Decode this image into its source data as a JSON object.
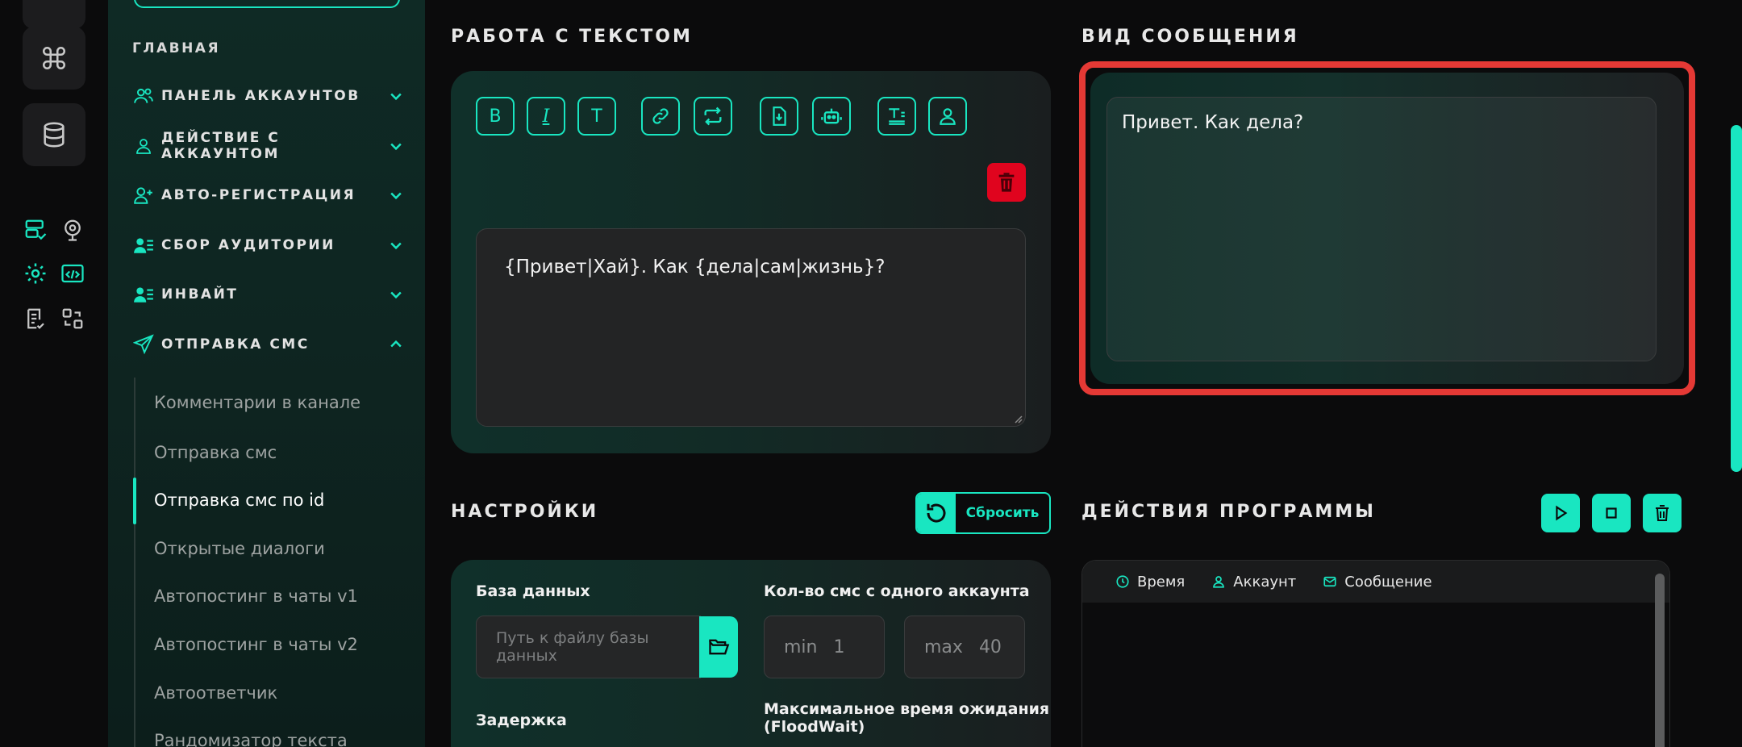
{
  "sidebar": {
    "section_title": "ГЛАВНАЯ",
    "items": [
      {
        "label": "ПАНЕЛЬ АККАУНТОВ",
        "icon": "users-icon",
        "expanded": false
      },
      {
        "label": "ДЕЙСТВИЕ С АККАУНТОМ",
        "icon": "user-icon",
        "expanded": false
      },
      {
        "label": "АВТО-РЕГИСТРАЦИЯ",
        "icon": "user-plus-icon",
        "expanded": false
      },
      {
        "label": "СБОР АУДИТОРИИ",
        "icon": "user-list-icon",
        "expanded": false
      },
      {
        "label": "ИНВАЙТ",
        "icon": "user-list-icon",
        "expanded": false
      },
      {
        "label": "ОТПРАВКА СМС",
        "icon": "send-icon",
        "expanded": true
      }
    ],
    "subitems": [
      "Комментарии в канале",
      "Отправка смс",
      "Отправка смс по id",
      "Открытые диалоги",
      "Автопостинг в чаты v1",
      "Автопостинг в чаты v2",
      "Автоответчик",
      "Рандомизатор текста"
    ],
    "active_subitem": "Отправка смс по id"
  },
  "text_work": {
    "title": "РАБОТА С ТЕКСТОМ",
    "toolbar": {
      "bold": "B",
      "italic": "I",
      "text": "T"
    },
    "textarea_value": "{Привет|Хай}. Как {дела|сам|жизнь}?"
  },
  "preview": {
    "title": "ВИД СООБЩЕНИЯ",
    "text": "Привет. Как дела?"
  },
  "settings": {
    "title": "НАСТРОЙКИ",
    "reset_label": "Сбросить",
    "database_label": "База данных",
    "database_placeholder": "Путь к файлу базы данных",
    "count_label": "Кол-во смс с одного аккаунта",
    "min_key": "min",
    "min_value": "1",
    "max_key": "max",
    "max_value": "40",
    "delay_label": "Задержка",
    "floodwait_label_1": "Максимальное время ожидания",
    "floodwait_label_2": "(FloodWait)"
  },
  "actions": {
    "title": "ДЕЙСТВИЯ ПРОГРАММЫ",
    "columns": [
      "Время",
      "Аккаунт",
      "Сообщение"
    ]
  },
  "colors": {
    "accent": "#19e6c1",
    "danger": "#e0041e",
    "highlight": "#e53935"
  }
}
